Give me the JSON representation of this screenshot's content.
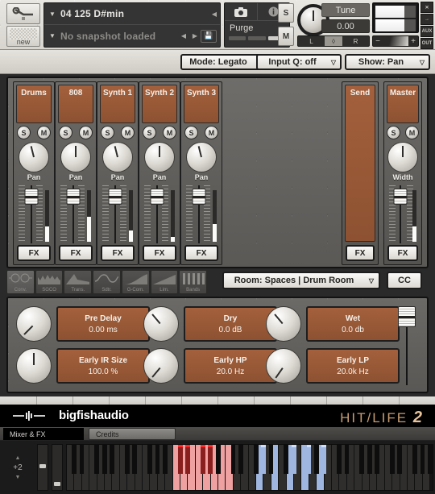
{
  "header": {
    "tool_wrench": "wrench-icon",
    "tool_new_label": "new",
    "instrument_name": "04 125 D#min",
    "snapshot_text": "No snapshot loaded",
    "purge_label": "Purge",
    "solo_label": "S",
    "mute_label": "M",
    "tune_label": "Tune",
    "tune_value": "0.00",
    "pan_left": "L",
    "pan_right": "R",
    "vol_minus": "−",
    "vol_plus": "+",
    "edge_buttons": [
      "✕",
      "→",
      "AUX",
      "OUT"
    ]
  },
  "toolbar": {
    "mode": "Mode: Legato",
    "input_q": "Input Q: off",
    "show": "Show: Pan"
  },
  "mixer": {
    "channels": [
      {
        "name": "Drums",
        "solo": "S",
        "mute": "M",
        "knob_label": "Pan",
        "fx": "FX",
        "meter_pct": 30
      },
      {
        "name": "808",
        "solo": "S",
        "mute": "M",
        "knob_label": "Pan",
        "fx": "FX",
        "meter_pct": 48
      },
      {
        "name": "Synth 1",
        "solo": "S",
        "mute": "M",
        "knob_label": "Pan",
        "fx": "FX",
        "meter_pct": 22
      },
      {
        "name": "Synth 2",
        "solo": "S",
        "mute": "M",
        "knob_label": "Pan",
        "fx": "FX",
        "meter_pct": 10
      },
      {
        "name": "Synth 3",
        "solo": "S",
        "mute": "M",
        "knob_label": "Pan",
        "fx": "FX",
        "meter_pct": 35
      }
    ],
    "send": {
      "name": "Send",
      "fx": "FX"
    },
    "master": {
      "name": "Master",
      "solo": "S",
      "mute": "M",
      "knob_label": "Width",
      "fx": "FX",
      "meter_pct": 30
    }
  },
  "fx_tabs": [
    {
      "label": "Conv.",
      "glyph": "convolution-icon",
      "active": true
    },
    {
      "label": "SGCO",
      "glyph": "saturation-icon",
      "active": false
    },
    {
      "label": "Trans.",
      "glyph": "transient-icon",
      "active": false
    },
    {
      "label": "Sdtr.",
      "glyph": "sine-icon",
      "active": false
    },
    {
      "label": "G-Com.",
      "glyph": "compressor-icon",
      "active": false
    },
    {
      "label": "Lim.",
      "glyph": "limiter-icon",
      "active": false
    },
    {
      "label": "Bands",
      "glyph": "bands-icon",
      "active": false
    }
  ],
  "room": {
    "dropdown": "Room: Spaces | Drum Room",
    "cc_label": "CC"
  },
  "params": [
    {
      "name": "Pre Delay",
      "value": "0.00 ms",
      "knob_angle": "a-135"
    },
    {
      "name": "Dry",
      "value": "0.0 dB",
      "knob_angle": "a-40"
    },
    {
      "name": "Wet",
      "value": "0.0 db",
      "knob_angle": "a-40"
    },
    {
      "name": "Early IR Size",
      "value": "100.0 %",
      "knob_angle": "a0"
    },
    {
      "name": "Early HP",
      "value": "20.0 Hz",
      "knob_angle": "a135"
    },
    {
      "name": "Early LP",
      "value": "20.0k Hz",
      "knob_angle": "a150"
    }
  ],
  "branding": {
    "company": "bigfishaudio",
    "product": "HIT/LIFE",
    "product_version": "2"
  },
  "tabs": {
    "selected": "Mixer & FX",
    "other": "Credits"
  },
  "keyboard": {
    "transpose": "+2",
    "up_arrow": "▲",
    "down_arrow": "▼"
  },
  "colors": {
    "accent_brown": "#a4603c",
    "panel_gray": "#6c6a67",
    "key_pink": "#efa0a0",
    "key_blue": "#9fb7e0",
    "key_green": "#2f8f2f",
    "key_dark_red": "#8a1f1f",
    "brand_copper": "#c79c72"
  }
}
